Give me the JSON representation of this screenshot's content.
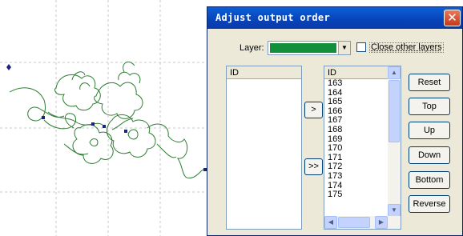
{
  "dialog": {
    "title": "Adjust output order",
    "close_symbol": "✕"
  },
  "layer": {
    "label": "Layer:",
    "selected_color": "#118f3a",
    "arrow": "▼"
  },
  "close_other_layers": {
    "label": "Close other layers",
    "checked": false
  },
  "left_list": {
    "header": "ID",
    "items": []
  },
  "right_list": {
    "header": "ID",
    "items": [
      "163",
      "164",
      "165",
      "166",
      "167",
      "168",
      "169",
      "170",
      "171",
      "172",
      "173",
      "174",
      "175"
    ]
  },
  "transfer_buttons": {
    "move_one": ">",
    "move_all": ">>"
  },
  "side_buttons": {
    "reset": "Reset",
    "top": "Top",
    "up": "Up",
    "down": "Down",
    "bottom": "Bottom",
    "reverse": "Reverse"
  },
  "scroll_icons": {
    "up": "▲",
    "down": "▼",
    "left": "◀",
    "right": "▶"
  },
  "colors": {
    "drawing_stroke": "#2e7d32",
    "node_marker": "#1a237e",
    "title_bar": "#0a5fd6"
  }
}
